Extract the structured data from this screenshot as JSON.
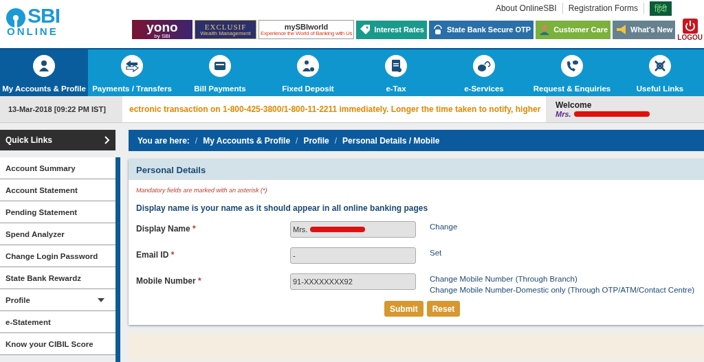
{
  "logo": {
    "title": "SBI",
    "subtitle": "ONLINE"
  },
  "top_links": [
    {
      "label": "About OnlineSBI",
      "kind": "link"
    },
    {
      "label": "Registration Forms",
      "kind": "link"
    },
    {
      "label": "हिंदी",
      "kind": "lang"
    }
  ],
  "banners": [
    {
      "kind": "yono",
      "text": "yono",
      "subtext": "by SBI"
    },
    {
      "kind": "exclusif",
      "text": "EXCLUSIF",
      "subtext": "Wealth Management"
    },
    {
      "kind": "world",
      "text": "mySBIworld",
      "subtext": "Experience the World of Banking with Us"
    }
  ],
  "quick_buttons": [
    {
      "label": "Interest Rates",
      "color": "#1a9a8c"
    },
    {
      "label": "State Bank Secure OTP",
      "color": "#2a6fa8"
    },
    {
      "label": "Customer Care",
      "color": "#7bb13c"
    },
    {
      "label": "What's New",
      "color": "#66818f"
    }
  ],
  "logout": {
    "label": "LOGOU"
  },
  "nav": [
    {
      "label": "My Accounts & Profile",
      "selected": true
    },
    {
      "label": "Payments / Transfers",
      "selected": false
    },
    {
      "label": "Bill Payments",
      "selected": false
    },
    {
      "label": "Fixed Deposit",
      "selected": false
    },
    {
      "label": "e-Tax",
      "selected": false
    },
    {
      "label": "e-Services",
      "selected": false
    },
    {
      "label": "Request & Enquiries",
      "selected": false
    },
    {
      "label": "Useful Links",
      "selected": false
    }
  ],
  "info_bar": {
    "datetime": "13-Mar-2018 [09:22 PM IST]",
    "ticker": "ectronic transaction on 1-800-425-3800/1-800-11-2211 immediately. Longer the time taken to notify, higher",
    "welcome": "Welcome",
    "user": "Mrs."
  },
  "sidebar": {
    "title": "Quick Links",
    "items": [
      {
        "label": "Account Summary"
      },
      {
        "label": "Account Statement"
      },
      {
        "label": "Pending Statement"
      },
      {
        "label": "Spend Analyzer"
      },
      {
        "label": "Change Login Password"
      },
      {
        "label": "State Bank Rewardz"
      },
      {
        "label": "Profile",
        "expanded": false
      },
      {
        "label": "e-Statement"
      },
      {
        "label": "Know your CIBIL Score"
      }
    ]
  },
  "breadcrumb": {
    "prefix": "You are here:",
    "separator": "/",
    "items": [
      "My Accounts & Profile",
      "Profile",
      "Personal Details / Mobile"
    ]
  },
  "panel": {
    "title": "Personal Details",
    "note": "Mandatory fields are marked with an asterisk (*)",
    "intro": "Display name is your name as it should appear in all online banking pages",
    "fields": [
      {
        "label": "Display Name",
        "required": "*",
        "value": "Mrs.",
        "redacted": true,
        "links": [
          "Change"
        ]
      },
      {
        "label": "Email ID",
        "required": "*",
        "value": "-",
        "redacted": false,
        "links": [
          "Set"
        ]
      },
      {
        "label": "Mobile Number",
        "required": "*",
        "value": "91-XXXXXXXX92",
        "redacted": false,
        "links": [
          "Change Mobile Number (Through Branch)",
          "Change Mobile Number-Domestic only (Through OTP/ATM/Contact Centre)"
        ]
      }
    ],
    "buttons": [
      "Submit",
      "Reset"
    ]
  }
}
